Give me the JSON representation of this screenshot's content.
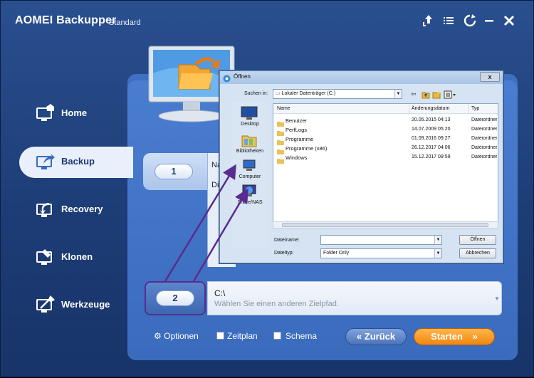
{
  "app": {
    "title": "AOMEI Backupper",
    "edition": "Standard"
  },
  "titlebar_icons": [
    "upgrade-icon",
    "menu-icon",
    "refresh-icon",
    "minimize-icon",
    "close-icon"
  ],
  "sidebar": {
    "items": [
      {
        "label": "Home",
        "icon": "home-icon"
      },
      {
        "label": "Backup",
        "icon": "backup-icon",
        "active": true
      },
      {
        "label": "Recovery",
        "icon": "recovery-icon"
      },
      {
        "label": "Klonen",
        "icon": "clone-icon"
      },
      {
        "label": "Werkzeuge",
        "icon": "tools-icon"
      }
    ]
  },
  "steps": {
    "step1": {
      "number": "1",
      "label_partial": "Na",
      "detail_partial": "Dis"
    },
    "step2": {
      "number": "2",
      "value": "C:\\",
      "hint": "Wählen Sie einen anderen Zielpfad."
    }
  },
  "bottom": {
    "options_label": "Optionen",
    "schedule_label": "Zeitplan",
    "scheme_label": "Schema",
    "back_label": "Zurück",
    "start_label": "Starten"
  },
  "dialog": {
    "title": "Öffnen",
    "close": "x",
    "lookin_label": "Suchen in:",
    "lookin_value": "Lokaler Datenträger (C:)",
    "places": [
      "Desktop",
      "Bibliotheken",
      "Computer",
      "Share/NAS"
    ],
    "columns": {
      "name": "Name",
      "date": "Änderungsdatum",
      "type": "Typ"
    },
    "files": [
      {
        "name": "Benutzer",
        "date": "20.05.2015 04:13",
        "type": "Dateiordner"
      },
      {
        "name": "PerfLogs",
        "date": "14.07.2009 05:20",
        "type": "Dateiordner"
      },
      {
        "name": "Programme",
        "date": "01.09.2016 09:27",
        "type": "Dateiordner"
      },
      {
        "name": "Programme (x86)",
        "date": "26.12.2017 04:06",
        "type": "Dateiordner"
      },
      {
        "name": "Windows",
        "date": "15.12.2017 09:59",
        "type": "Dateiordner"
      }
    ],
    "filename_label": "Dateiname:",
    "filename_value": "",
    "filetype_label": "Dateityp:",
    "filetype_value": "Folder Only",
    "open_button": "Öffnen",
    "cancel_button": "Abbrechen"
  },
  "colors": {
    "background": "#1d3d77",
    "panel": "#3f6fc1",
    "accent_start": "#f1860f",
    "annotation": "#5a2b90"
  }
}
